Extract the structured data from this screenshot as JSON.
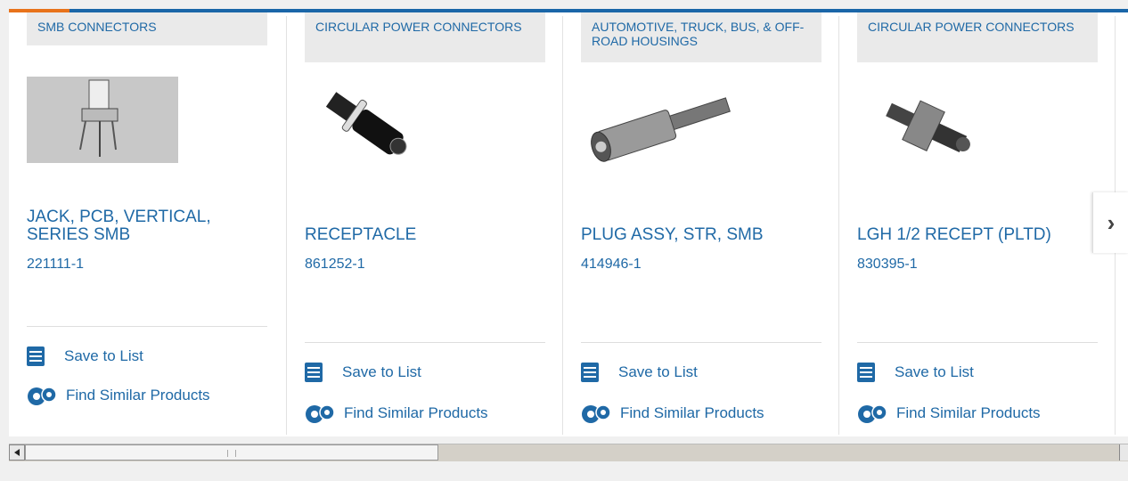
{
  "products": [
    {
      "category": "SMB CONNECTORS",
      "title": "JACK, PCB, VERTICAL, SERIES SMB",
      "part_number": "221111-1",
      "save_label": "Save to List",
      "similar_label": "Find Similar Products",
      "image_icon": "smb-jack-photo"
    },
    {
      "category": "CIRCULAR POWER CONNECTORS",
      "title": "RECEPTACLE",
      "part_number": "861252-1",
      "save_label": "Save to List",
      "similar_label": "Find Similar Products",
      "image_icon": "receptacle-photo"
    },
    {
      "category": "AUTOMOTIVE, TRUCK, BUS, & OFF-ROAD HOUSINGS",
      "title": "PLUG ASSY, STR, SMB",
      "part_number": "414946-1",
      "save_label": "Save to List",
      "similar_label": "Find Similar Products",
      "image_icon": "plug-assembly-photo"
    },
    {
      "category": "CIRCULAR POWER CONNECTORS",
      "title": "LGH 1/2 RECEPT (PLTD)",
      "part_number": "830395-1",
      "save_label": "Save to List",
      "similar_label": "Find Similar Products",
      "image_icon": "flange-receptacle-photo"
    }
  ],
  "carousel": {
    "next_icon": "chevron-right-icon"
  },
  "colors": {
    "link": "#1f69a6",
    "accent": "#e8731b",
    "brand": "#1a66a8"
  }
}
